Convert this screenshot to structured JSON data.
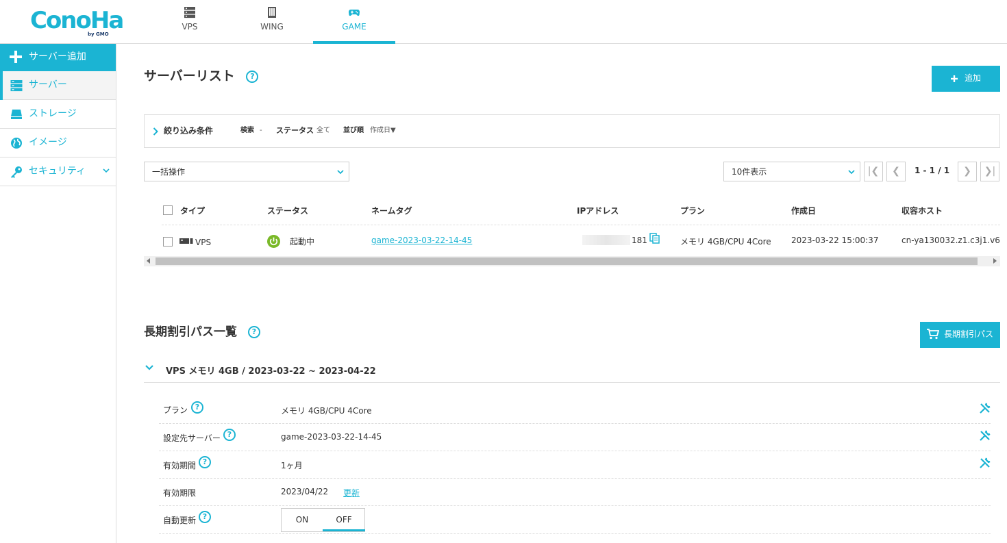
{
  "brand": {
    "logo": "ConoHa",
    "logo_sub": "by GMO"
  },
  "colors": {
    "accent": "#1bb4d3",
    "running": "#7ab929"
  },
  "nav": {
    "tabs": [
      {
        "label": "VPS",
        "icon": "server-rack-icon"
      },
      {
        "label": "WING",
        "icon": "building-icon"
      },
      {
        "label": "GAME",
        "icon": "gamepad-icon",
        "active": true
      }
    ]
  },
  "sidebar": {
    "add_label": "サーバー追加",
    "items": [
      {
        "label": "サーバー",
        "icon": "server-icon",
        "active": true
      },
      {
        "label": "ストレージ",
        "icon": "storage-icon"
      },
      {
        "label": "イメージ",
        "icon": "globe-icon"
      },
      {
        "label": "セキュリティ",
        "icon": "key-icon",
        "expandable": true
      }
    ]
  },
  "server_list": {
    "title": "サーバーリスト",
    "help": "?",
    "add_button": "追加",
    "filter": {
      "label": "絞り込み条件",
      "search_label": "検索",
      "search_value": "-",
      "status_label": "ステータス",
      "status_value": "全て",
      "sort_label": "並び順",
      "sort_value": "作成日▼"
    },
    "bulk_action": "一括操作",
    "page_size": "10件表示",
    "pagination": {
      "first": "|❮",
      "prev": "❮",
      "text": "1 - 1 / 1",
      "next": "❯",
      "last": "❯|"
    },
    "columns": [
      "タイプ",
      "ステータス",
      "ネームタグ",
      "IPアドレス",
      "プラン",
      "作成日",
      "収容ホスト"
    ],
    "rows": [
      {
        "type": "VPS",
        "status": "起動中",
        "name_tag": "game-2023-03-22-14-45",
        "ip_suffix": "181",
        "plan": "メモリ 4GB/CPU 4Core",
        "created": "2023-03-22 15:00:37",
        "host": "cn-ya130032.z1.c3j1.v6"
      }
    ]
  },
  "pass_list": {
    "title": "長期割引パス一覧",
    "help": "?",
    "button": "長期割引パス",
    "pass_header": "VPS メモリ 4GB / 2023-03-22 ~ 2023-04-22",
    "details": {
      "plan_label": "プラン",
      "plan_value": "メモリ 4GB/CPU 4Core",
      "target_label": "設定先サーバー",
      "target_value": "game-2023-03-22-14-45",
      "period_label": "有効期間",
      "period_value": "1ヶ月",
      "expiry_label": "有効期限",
      "expiry_value": "2023/04/22",
      "renew_link": "更新",
      "auto_label": "自動更新",
      "auto_on": "ON",
      "auto_off": "OFF"
    }
  }
}
